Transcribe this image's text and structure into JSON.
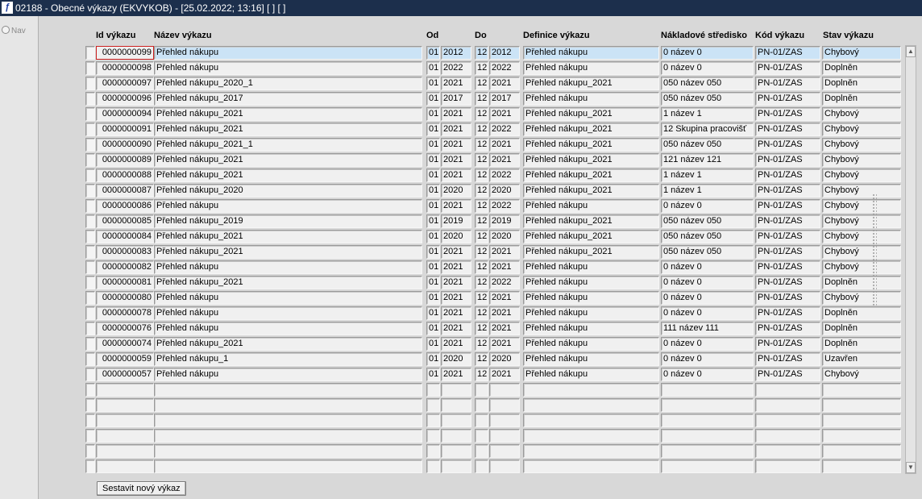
{
  "window": {
    "logo": "ƒ",
    "title": "02188 - Obecné výkazy (EKVYKOB) - [25.02.2022; 13:16]  [ ]  [ ]"
  },
  "nav": {
    "label": "Nav"
  },
  "columns": {
    "id": "Id výkazu",
    "name": "Název výkazu",
    "from": "Od",
    "to": "Do",
    "definition": "Definice výkazu",
    "cost_center": "Nákladové středisko",
    "code": "Kód výkazu",
    "status": "Stav výkazu"
  },
  "rows": [
    {
      "id": "0000000099",
      "name": "Přehled nákupu",
      "from_m": "01",
      "from_y": "2012",
      "to_m": "12",
      "to_y": "2012",
      "definition": "Přehled nákupu",
      "cost_center": "0 název 0",
      "code": "PN-01/ZAS",
      "status": "Chybový"
    },
    {
      "id": "0000000098",
      "name": "Přehled nákupu",
      "from_m": "01",
      "from_y": "2022",
      "to_m": "12",
      "to_y": "2022",
      "definition": "Přehled nákupu",
      "cost_center": "0 název 0",
      "code": "PN-01/ZAS",
      "status": "Doplněn"
    },
    {
      "id": "0000000097",
      "name": "Přehled nákupu_2020_1",
      "from_m": "01",
      "from_y": "2021",
      "to_m": "12",
      "to_y": "2021",
      "definition": "Přehled nákupu_2021",
      "cost_center": "050 název 050",
      "code": "PN-01/ZAS",
      "status": "Doplněn"
    },
    {
      "id": "0000000096",
      "name": "Přehled nákupu_2017",
      "from_m": "01",
      "from_y": "2017",
      "to_m": "12",
      "to_y": "2017",
      "definition": "Přehled nákupu",
      "cost_center": "050 název 050",
      "code": "PN-01/ZAS",
      "status": "Doplněn"
    },
    {
      "id": "0000000094",
      "name": "Přehled nákupu_2021",
      "from_m": "01",
      "from_y": "2021",
      "to_m": "12",
      "to_y": "2021",
      "definition": "Přehled nákupu_2021",
      "cost_center": "1 název 1",
      "code": "PN-01/ZAS",
      "status": "Chybový"
    },
    {
      "id": "0000000091",
      "name": "Přehled nákupu_2021",
      "from_m": "01",
      "from_y": "2021",
      "to_m": "12",
      "to_y": "2022",
      "definition": "Přehled nákupu_2021",
      "cost_center": "12 Skupina pracovišť",
      "code": "PN-01/ZAS",
      "status": "Chybový"
    },
    {
      "id": "0000000090",
      "name": "Přehled nákupu_2021_1",
      "from_m": "01",
      "from_y": "2021",
      "to_m": "12",
      "to_y": "2021",
      "definition": "Přehled nákupu_2021",
      "cost_center": "050 název 050",
      "code": "PN-01/ZAS",
      "status": "Chybový"
    },
    {
      "id": "0000000089",
      "name": "Přehled nákupu_2021",
      "from_m": "01",
      "from_y": "2021",
      "to_m": "12",
      "to_y": "2021",
      "definition": "Přehled nákupu_2021",
      "cost_center": "121 název 121",
      "code": "PN-01/ZAS",
      "status": "Chybový"
    },
    {
      "id": "0000000088",
      "name": "Přehled nákupu_2021",
      "from_m": "01",
      "from_y": "2021",
      "to_m": "12",
      "to_y": "2022",
      "definition": "Přehled nákupu_2021",
      "cost_center": "1 název 1",
      "code": "PN-01/ZAS",
      "status": "Chybový"
    },
    {
      "id": "0000000087",
      "name": "Přehled nákupu_2020",
      "from_m": "01",
      "from_y": "2020",
      "to_m": "12",
      "to_y": "2020",
      "definition": "Přehled nákupu_2021",
      "cost_center": "1 název 1",
      "code": "PN-01/ZAS",
      "status": "Chybový"
    },
    {
      "id": "0000000086",
      "name": "Přehled nákupu",
      "from_m": "01",
      "from_y": "2021",
      "to_m": "12",
      "to_y": "2022",
      "definition": "Přehled nákupu",
      "cost_center": "0 název 0",
      "code": "PN-01/ZAS",
      "status": "Chybový"
    },
    {
      "id": "0000000085",
      "name": "Přehled nákupu_2019",
      "from_m": "01",
      "from_y": "2019",
      "to_m": "12",
      "to_y": "2019",
      "definition": "Přehled nákupu_2021",
      "cost_center": "050 název 050",
      "code": "PN-01/ZAS",
      "status": "Chybový"
    },
    {
      "id": "0000000084",
      "name": "Přehled nákupu_2021",
      "from_m": "01",
      "from_y": "2020",
      "to_m": "12",
      "to_y": "2020",
      "definition": "Přehled nákupu_2021",
      "cost_center": "050 název 050",
      "code": "PN-01/ZAS",
      "status": "Chybový"
    },
    {
      "id": "0000000083",
      "name": "Přehled nákupu_2021",
      "from_m": "01",
      "from_y": "2021",
      "to_m": "12",
      "to_y": "2021",
      "definition": "Přehled nákupu_2021",
      "cost_center": "050 název 050",
      "code": "PN-01/ZAS",
      "status": "Chybový"
    },
    {
      "id": "0000000082",
      "name": "Přehled nákupu",
      "from_m": "01",
      "from_y": "2021",
      "to_m": "12",
      "to_y": "2021",
      "definition": "Přehled nákupu",
      "cost_center": "0 název 0",
      "code": "PN-01/ZAS",
      "status": "Chybový"
    },
    {
      "id": "0000000081",
      "name": "Přehled nákupu_2021",
      "from_m": "01",
      "from_y": "2021",
      "to_m": "12",
      "to_y": "2022",
      "definition": "Přehled nákupu",
      "cost_center": "0 název 0",
      "code": "PN-01/ZAS",
      "status": "Doplněn"
    },
    {
      "id": "0000000080",
      "name": "Přehled nákupu",
      "from_m": "01",
      "from_y": "2021",
      "to_m": "12",
      "to_y": "2021",
      "definition": "Přehled nákupu",
      "cost_center": "0 název 0",
      "code": "PN-01/ZAS",
      "status": "Chybový"
    },
    {
      "id": "0000000078",
      "name": "Přehled nákupu",
      "from_m": "01",
      "from_y": "2021",
      "to_m": "12",
      "to_y": "2021",
      "definition": "Přehled nákupu",
      "cost_center": "0 název 0",
      "code": "PN-01/ZAS",
      "status": "Doplněn"
    },
    {
      "id": "0000000076",
      "name": "Přehled nákupu",
      "from_m": "01",
      "from_y": "2021",
      "to_m": "12",
      "to_y": "2021",
      "definition": "Přehled nákupu",
      "cost_center": "111 název 111",
      "code": "PN-01/ZAS",
      "status": "Doplněn"
    },
    {
      "id": "0000000074",
      "name": "Přehled nákupu_2021",
      "from_m": "01",
      "from_y": "2021",
      "to_m": "12",
      "to_y": "2021",
      "definition": "Přehled nákupu",
      "cost_center": "0 název 0",
      "code": "PN-01/ZAS",
      "status": "Doplněn"
    },
    {
      "id": "0000000059",
      "name": "Přehled nákupu_1",
      "from_m": "01",
      "from_y": "2020",
      "to_m": "12",
      "to_y": "2020",
      "definition": "Přehled nákupu",
      "cost_center": "0 název 0",
      "code": "PN-01/ZAS",
      "status": "Uzavřen"
    },
    {
      "id": "0000000057",
      "name": "Přehled nákupu",
      "from_m": "01",
      "from_y": "2021",
      "to_m": "12",
      "to_y": "2021",
      "definition": "Přehled nákupu",
      "cost_center": "0 název 0",
      "code": "PN-01/ZAS",
      "status": "Chybový"
    },
    {
      "id": "",
      "name": "",
      "from_m": "",
      "from_y": "",
      "to_m": "",
      "to_y": "",
      "definition": "",
      "cost_center": "",
      "code": "",
      "status": ""
    },
    {
      "id": "",
      "name": "",
      "from_m": "",
      "from_y": "",
      "to_m": "",
      "to_y": "",
      "definition": "",
      "cost_center": "",
      "code": "",
      "status": ""
    },
    {
      "id": "",
      "name": "",
      "from_m": "",
      "from_y": "",
      "to_m": "",
      "to_y": "",
      "definition": "",
      "cost_center": "",
      "code": "",
      "status": ""
    },
    {
      "id": "",
      "name": "",
      "from_m": "",
      "from_y": "",
      "to_m": "",
      "to_y": "",
      "definition": "",
      "cost_center": "",
      "code": "",
      "status": ""
    },
    {
      "id": "",
      "name": "",
      "from_m": "",
      "from_y": "",
      "to_m": "",
      "to_y": "",
      "definition": "",
      "cost_center": "",
      "code": "",
      "status": ""
    },
    {
      "id": "",
      "name": "",
      "from_m": "",
      "from_y": "",
      "to_m": "",
      "to_y": "",
      "definition": "",
      "cost_center": "",
      "code": "",
      "status": ""
    }
  ],
  "selected_row": 0,
  "scrollbar": {
    "up_glyph": "▲",
    "down_glyph": "▼"
  },
  "actions": {
    "new_report": "Sestavit nový výkaz"
  }
}
